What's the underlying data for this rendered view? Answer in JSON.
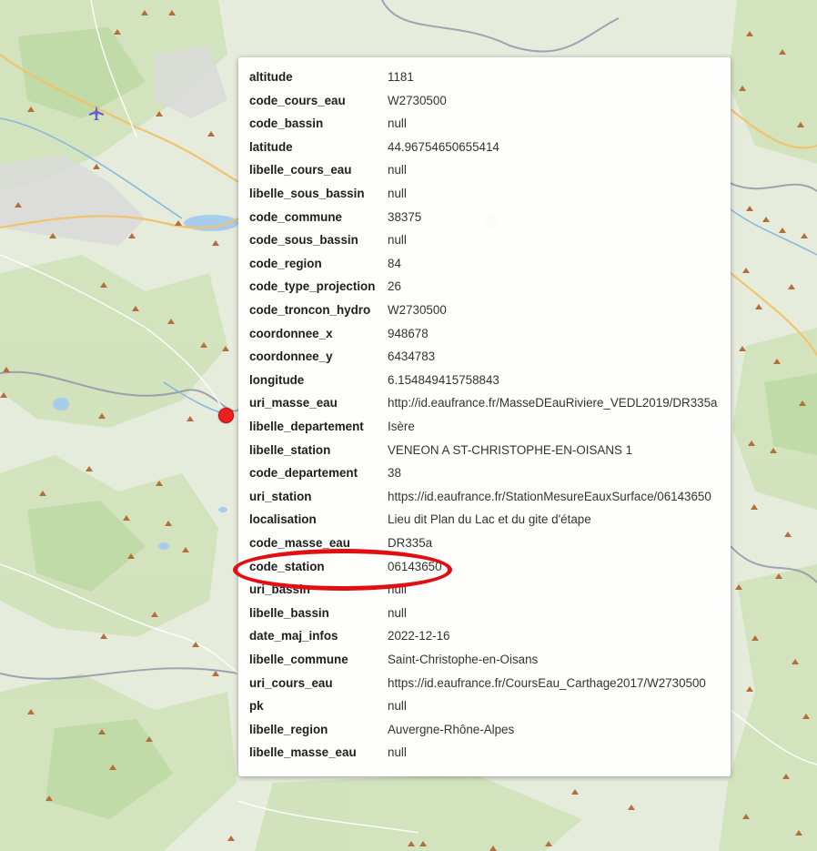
{
  "map": {
    "peak_icon_color": "#b26f3b",
    "marker_color": "#f01f1f",
    "airport_icon": "airplane-icon",
    "peak_icon": "mountain-peak-icon"
  },
  "popup": {
    "rows": [
      {
        "key": "altitude",
        "value": "1181"
      },
      {
        "key": "code_cours_eau",
        "value": "W2730500"
      },
      {
        "key": "code_bassin",
        "value": "null"
      },
      {
        "key": "latitude",
        "value": "44.96754650655414"
      },
      {
        "key": "libelle_cours_eau",
        "value": "null"
      },
      {
        "key": "libelle_sous_bassin",
        "value": "null"
      },
      {
        "key": "code_commune",
        "value": "38375"
      },
      {
        "key": "code_sous_bassin",
        "value": "null"
      },
      {
        "key": "code_region",
        "value": "84"
      },
      {
        "key": "code_type_projection",
        "value": "26"
      },
      {
        "key": "code_troncon_hydro",
        "value": "W2730500"
      },
      {
        "key": "coordonnee_x",
        "value": "948678"
      },
      {
        "key": "coordonnee_y",
        "value": "6434783"
      },
      {
        "key": "longitude",
        "value": "6.154849415758843"
      },
      {
        "key": "uri_masse_eau",
        "value": "http://id.eaufrance.fr/MasseDEauRiviere_VEDL2019/DR335a"
      },
      {
        "key": "libelle_departement",
        "value": "Isère"
      },
      {
        "key": "libelle_station",
        "value": "VENEON A ST-CHRISTOPHE-EN-OISANS 1"
      },
      {
        "key": "code_departement",
        "value": "38"
      },
      {
        "key": "uri_station",
        "value": "https://id.eaufrance.fr/StationMesureEauxSurface/06143650"
      },
      {
        "key": "localisation",
        "value": "Lieu dit Plan du Lac et du gite d'étape"
      },
      {
        "key": "code_masse_eau",
        "value": "DR335a"
      },
      {
        "key": "code_station",
        "value": "06143650"
      },
      {
        "key": "uri_bassin",
        "value": "null"
      },
      {
        "key": "libelle_bassin",
        "value": "null"
      },
      {
        "key": "date_maj_infos",
        "value": "2022-12-16"
      },
      {
        "key": "libelle_commune",
        "value": "Saint-Christophe-en-Oisans"
      },
      {
        "key": "uri_cours_eau",
        "value": "https://id.eaufrance.fr/CoursEau_Carthage2017/W2730500"
      },
      {
        "key": "pk",
        "value": "null"
      },
      {
        "key": "libelle_region",
        "value": "Auvergne-Rhône-Alpes"
      },
      {
        "key": "libelle_masse_eau",
        "value": "null"
      }
    ],
    "highlight_color": "#e10f12"
  }
}
